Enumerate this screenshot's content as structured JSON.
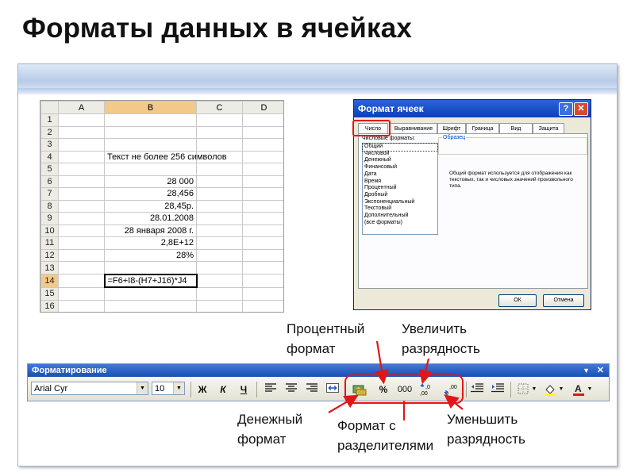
{
  "slide": {
    "title": "Форматы данных в ячейках"
  },
  "sheet": {
    "columns": [
      "A",
      "B",
      "C",
      "D"
    ],
    "rows": [
      {
        "num": "1",
        "b": ""
      },
      {
        "num": "2",
        "b": ""
      },
      {
        "num": "3",
        "b": ""
      },
      {
        "num": "4",
        "b": "Текст не более 256 символов"
      },
      {
        "num": "5",
        "b": ""
      },
      {
        "num": "6",
        "b": "28 000"
      },
      {
        "num": "7",
        "b": "28,456"
      },
      {
        "num": "8",
        "b": "28,45р."
      },
      {
        "num": "9",
        "b": "28.01.2008"
      },
      {
        "num": "10",
        "b": "28 января 2008 г."
      },
      {
        "num": "11",
        "b": "2,8E+12"
      },
      {
        "num": "12",
        "b": "28%"
      },
      {
        "num": "13",
        "b": ""
      },
      {
        "num": "14",
        "b": "=F6+I8-(H7+J16)*J4"
      },
      {
        "num": "15",
        "b": ""
      },
      {
        "num": "16",
        "b": ""
      }
    ]
  },
  "dialog": {
    "title": "Формат ячеек",
    "help": "?",
    "close": "✕",
    "tabs": [
      "Число",
      "Выравнивание",
      "Шрифт",
      "Граница",
      "Вид",
      "Защита"
    ],
    "formats_label": "Числовые форматы:",
    "formats": [
      "Общий",
      "Числовой",
      "Денежный",
      "Финансовый",
      "Дата",
      "Время",
      "Процентный",
      "Дробный",
      "Экспоненциальный",
      "Текстовый",
      "Дополнительный",
      "(все форматы)"
    ],
    "sample_label": "Образец",
    "description": "Общий формат используется для отображения как текстовых, так и числовых значений произвольного типа.",
    "ok": "ОК",
    "cancel": "Отмена"
  },
  "toolbar": {
    "title": "Форматирование",
    "menu_arrow": "▼",
    "close": "✕",
    "font": "Arial Cyr",
    "size": "10",
    "bold": "Ж",
    "italic": "К",
    "underline": "Ч",
    "percent": "%",
    "thousands": "000"
  },
  "annotations": {
    "percent": [
      "Процентный",
      "формат"
    ],
    "increase": [
      "Увеличить",
      "разрядность"
    ],
    "currency": [
      "Денежный",
      "формат"
    ],
    "separators": [
      "Формат с",
      "разделителями"
    ],
    "decrease": [
      "Уменьшить",
      "разрядность"
    ]
  },
  "colors": {
    "highlight": "#e21616",
    "title_bar": "#0a3fb8",
    "selected_header": "#f3c98a"
  }
}
